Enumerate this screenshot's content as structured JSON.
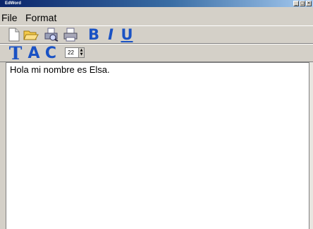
{
  "window": {
    "title": "EdWord"
  },
  "menu": {
    "items": [
      "File",
      "Format"
    ]
  },
  "toolbar": {
    "buttons": [
      {
        "name": "new-file-icon"
      },
      {
        "name": "open-folder-icon"
      },
      {
        "name": "print-preview-icon"
      },
      {
        "name": "print-icon"
      }
    ],
    "bold_label": "B",
    "italic_label": "I",
    "underline_label": "U"
  },
  "format_toolbar": {
    "text_label": "T",
    "align_label": "A",
    "color_label": "C",
    "font_size": "22"
  },
  "editor": {
    "content": "Hola mi nombre es Elsa."
  },
  "colors": {
    "accent": "#1a52c4",
    "title_bar": "#0a246a",
    "chrome": "#d4d0c8"
  }
}
